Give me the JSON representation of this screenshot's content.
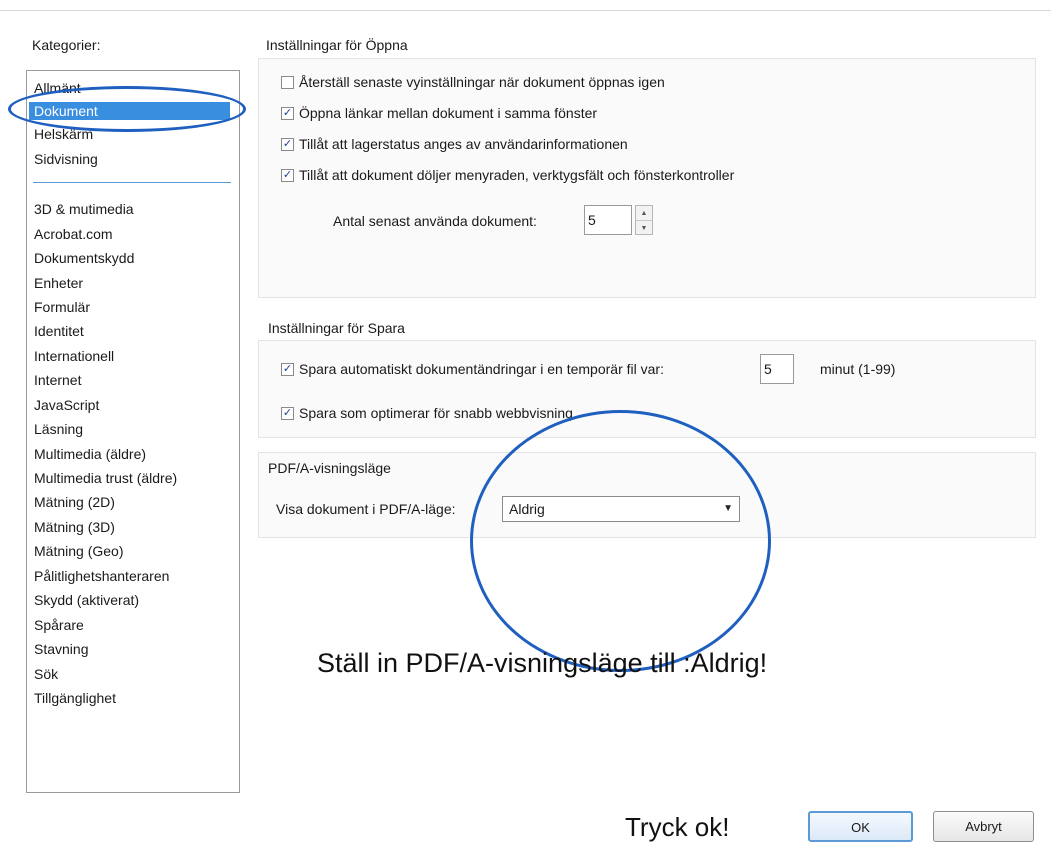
{
  "categories": {
    "label": "Kategorier:",
    "top_items": [
      "Allmänt",
      "Dokument",
      "Helskärm",
      "Sidvisning"
    ],
    "selected": "Dokument",
    "items": [
      "3D & mutimedia",
      "Acrobat.com",
      "Dokumentskydd",
      "Enheter",
      "Formulär",
      "Identitet",
      "Internationell",
      "Internet",
      "JavaScript",
      "Läsning",
      "Multimedia (äldre)",
      "Multimedia trust (äldre)",
      "Mätning (2D)",
      "Mätning (3D)",
      "Mätning (Geo)",
      "Pålitlighetshanteraren",
      "Skydd (aktiverat)",
      "Spårare",
      "Stavning",
      "Sök",
      "Tillgänglighet"
    ]
  },
  "open_settings": {
    "title": "Inställningar för Öppna",
    "options": [
      {
        "label": "Återställ senaste vyinställningar när dokument öppnas igen",
        "checked": false
      },
      {
        "label": "Öppna länkar mellan dokument i samma fönster",
        "checked": true
      },
      {
        "label": "Tillåt att lagerstatus anges av användarinformationen",
        "checked": true
      },
      {
        "label": "Tillåt att dokument döljer menyraden, verktygsfält och fönsterkontroller",
        "checked": true
      }
    ],
    "recent_label": "Antal senast använda dokument:",
    "recent_value": "5"
  },
  "save_settings": {
    "title": "Inställningar för Spara",
    "autosave_label": "Spara automatiskt dokumentändringar i en temporär fil var:",
    "autosave_checked": true,
    "autosave_value": "5",
    "autosave_unit": "minut (1-99)",
    "optimize_label": "Spara som optimerar för snabb webbvisning",
    "optimize_checked": true
  },
  "pdfa": {
    "title": "PDF/A-visningsläge",
    "label": "Visa dokument i PDF/A-läge:",
    "value": "Aldrig"
  },
  "annotations": {
    "instruction": "Ställ in PDF/A-visningsläge till :Aldrig!",
    "press_ok": "Tryck ok!"
  },
  "buttons": {
    "ok": "OK",
    "cancel": "Avbryt"
  },
  "colors": {
    "selection": "#3a8ee0",
    "annotation_ellipse": "#1f5fbf",
    "check_mark": "#1d3f8a"
  }
}
